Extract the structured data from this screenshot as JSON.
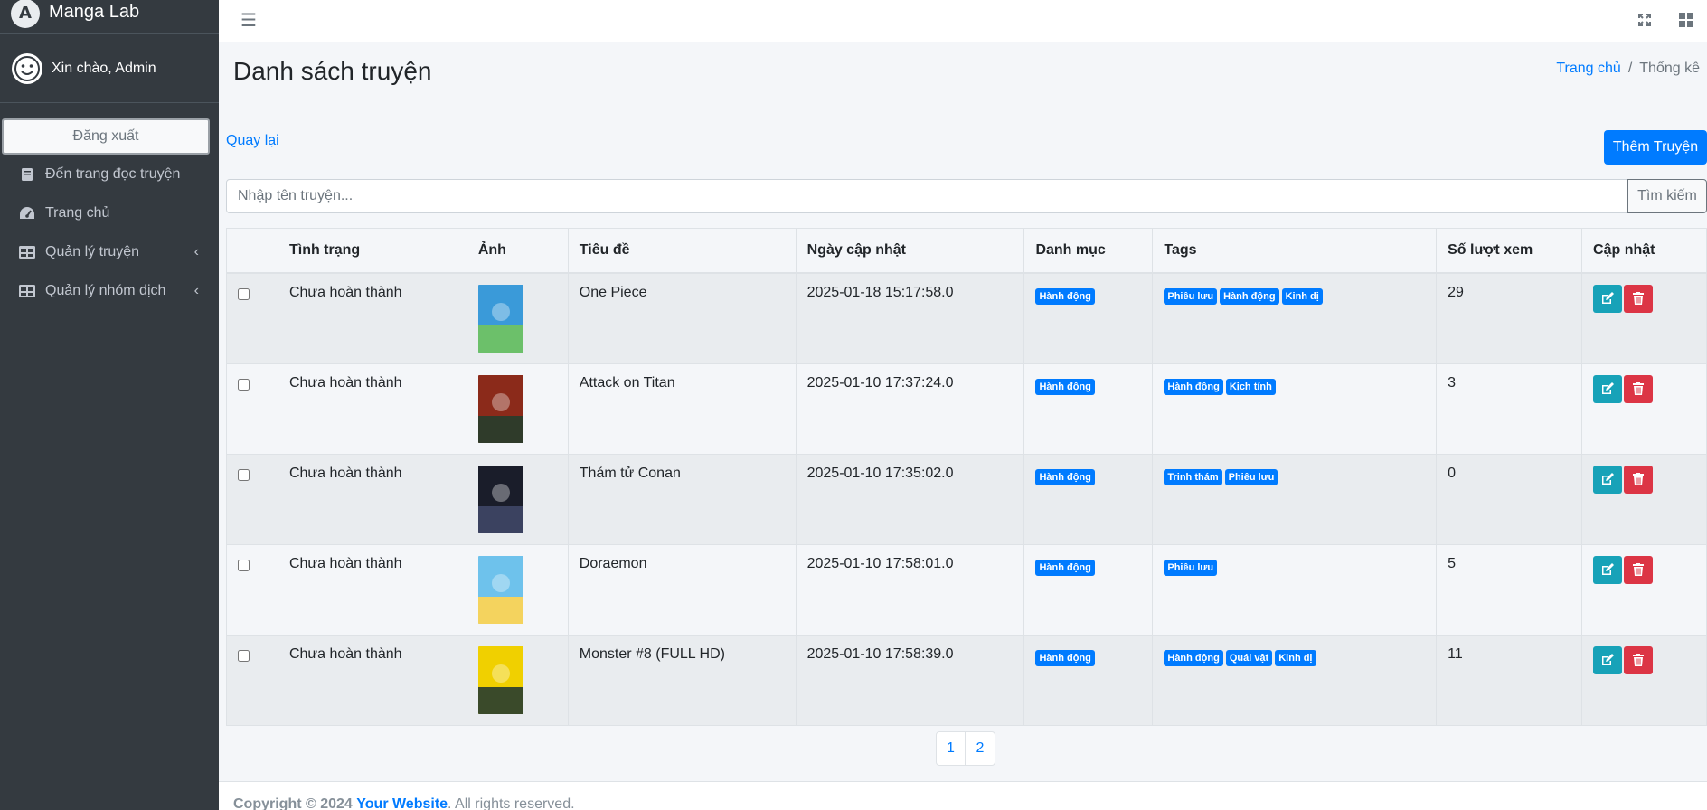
{
  "brand": {
    "name": "Manga Lab",
    "logo_letter": "A"
  },
  "user": {
    "greeting": "Xin chào, Admin"
  },
  "sidebar": {
    "logout_label": "Đăng xuất",
    "items": [
      {
        "label": "Đến trang đọc truyện",
        "icon": "book-icon"
      },
      {
        "label": "Trang chủ",
        "icon": "dashboard-icon"
      },
      {
        "label": "Quản lý truyện",
        "icon": "table-icon",
        "chevron": "‹"
      },
      {
        "label": "Quản lý nhóm dịch",
        "icon": "table-icon",
        "chevron": "‹"
      }
    ]
  },
  "header": {
    "menu_icon": "☰"
  },
  "page": {
    "title": "Danh sách truyện",
    "breadcrumb": {
      "home": "Trang chủ",
      "sep": "/",
      "current": "Thống kê"
    },
    "back_label": "Quay lại",
    "add_label": "Thêm Truyện"
  },
  "search": {
    "placeholder": "Nhập tên truyện...",
    "button_label": "Tìm kiếm"
  },
  "table": {
    "headers": [
      "",
      "Tình trạng",
      "Ảnh",
      "Tiêu đề",
      "Ngày cập nhật",
      "Danh mục",
      "Tags",
      "Số lượt xem",
      "Cập nhật"
    ],
    "rows": [
      {
        "status": "Chưa hoàn thành",
        "title": "One Piece",
        "updated": "2025-01-18 15:17:58.0",
        "category": "Hành động",
        "tags": [
          "Phiêu lưu",
          "Hành động",
          "Kinh dị"
        ],
        "views": "29",
        "cover_colors": [
          "#3a9ad9",
          "#6cc06a"
        ]
      },
      {
        "status": "Chưa hoàn thành",
        "title": "Attack on Titan",
        "updated": "2025-01-10 17:37:24.0",
        "category": "Hành động",
        "tags": [
          "Hành động",
          "Kịch tính"
        ],
        "views": "3",
        "cover_colors": [
          "#8b2a1a",
          "#2f3b2a"
        ]
      },
      {
        "status": "Chưa hoàn thành",
        "title": "Thám tử Conan",
        "updated": "2025-01-10 17:35:02.0",
        "category": "Hành động",
        "tags": [
          "Trinh thám",
          "Phiêu lưu"
        ],
        "views": "0",
        "cover_colors": [
          "#1a1d2a",
          "#3b4260"
        ]
      },
      {
        "status": "Chưa hoàn thành",
        "title": "Doraemon",
        "updated": "2025-01-10 17:58:01.0",
        "category": "Hành động",
        "tags": [
          "Phiêu lưu"
        ],
        "views": "5",
        "cover_colors": [
          "#6ec2ec",
          "#f4d35e"
        ]
      },
      {
        "status": "Chưa hoàn thành",
        "title": "Monster #8 (FULL HD)",
        "updated": "2025-01-10 17:58:39.0",
        "category": "Hành động",
        "tags": [
          "Hành động",
          "Quái vật",
          "Kinh dị"
        ],
        "views": "11",
        "cover_colors": [
          "#f0d000",
          "#3a4a2a"
        ]
      }
    ]
  },
  "pagination": {
    "pages": [
      "1",
      "2"
    ]
  },
  "footer": {
    "copyright": "Copyright © 2024",
    "site": "Your Website",
    "rights": ". All rights reserved."
  },
  "colors": {
    "primary": "#007bff",
    "edit": "#17a2b8",
    "delete": "#dc3545",
    "sidebar": "#343a40"
  }
}
